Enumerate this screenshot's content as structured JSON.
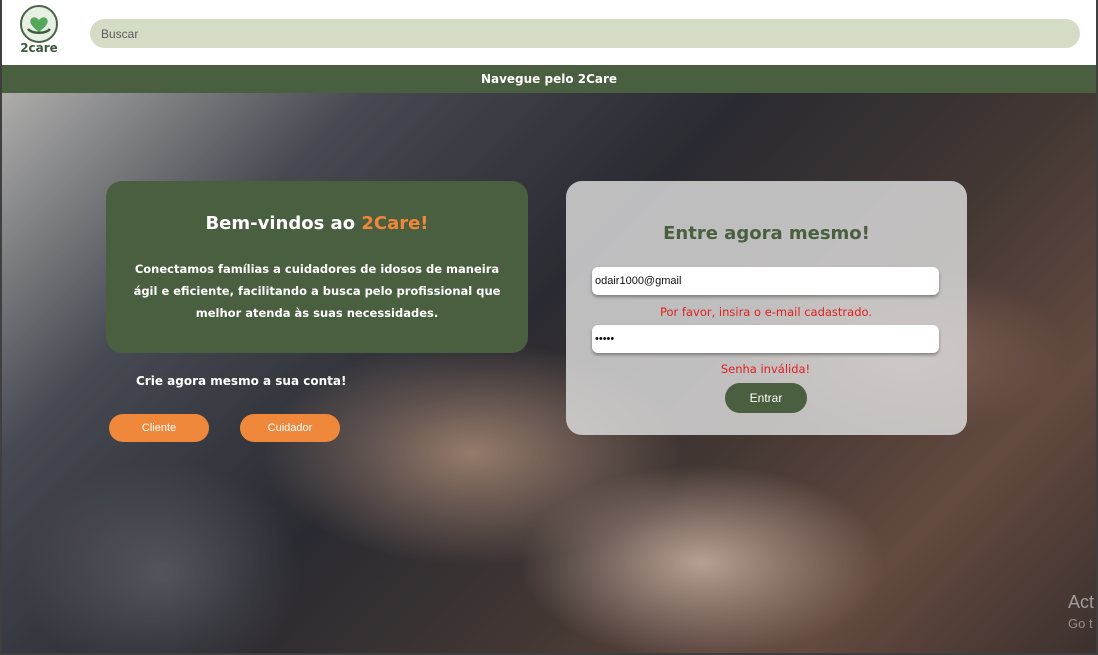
{
  "header": {
    "logo_text": "2care",
    "search_placeholder": "Buscar"
  },
  "nav": {
    "label": "Navegue pelo 2Care"
  },
  "welcome": {
    "title_prefix": "Bem-vindos ao ",
    "title_accent": "2Care!",
    "description": "Conectamos famílias a cuidadores de idosos de maneira ágil e eficiente, facilitando a busca pelo profissional que melhor atenda às suas necessidades."
  },
  "signup": {
    "prompt": "Crie agora mesmo a sua conta!",
    "client_label": "Cliente",
    "carer_label": "Cuidador"
  },
  "login": {
    "title": "Entre agora mesmo!",
    "email_value": "odair1000@gmail",
    "email_error": "Por favor, insira o e-mail cadastrado.",
    "password_value": "•••••",
    "password_error": "Senha inválida!",
    "submit_label": "Entrar"
  },
  "watermark": {
    "line1": "Act",
    "line2": "Go t"
  },
  "colors": {
    "brand_green": "#4a5e40",
    "accent_orange": "#f0883b",
    "error_red": "#e02020",
    "search_bg": "#d4dcc6"
  }
}
